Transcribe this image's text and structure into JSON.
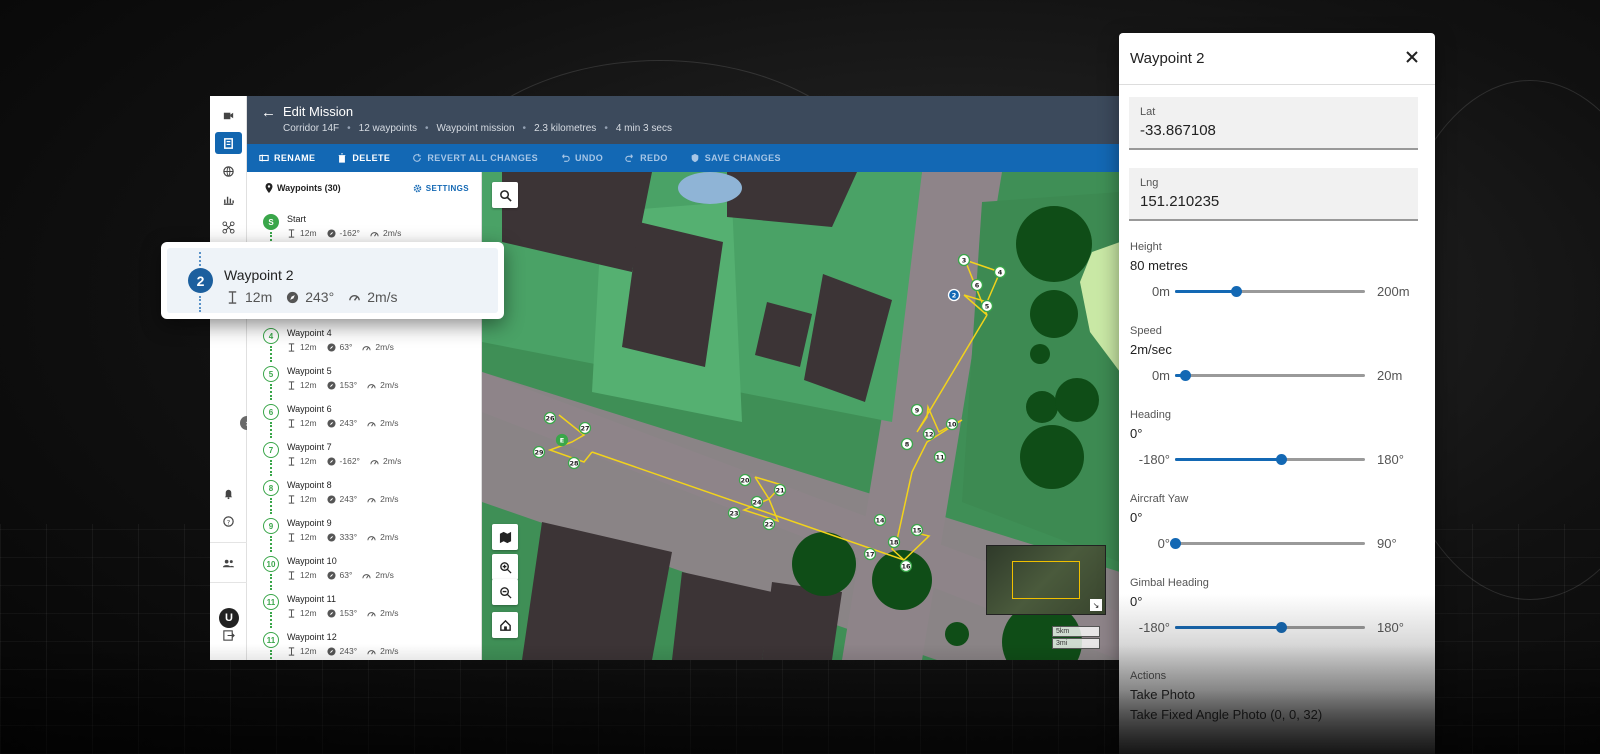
{
  "app": {
    "title": "Edit Mission",
    "meta": [
      "Corridor 14F",
      "12 waypoints",
      "Waypoint mission",
      "2.3 kilometres",
      "4 min 3 secs"
    ]
  },
  "toolbar": {
    "rename": "RENAME",
    "delete": "DELETE",
    "revert": "REVERT ALL CHANGES",
    "undo": "UNDO",
    "redo": "REDO",
    "save": "SAVE CHANGES"
  },
  "list": {
    "header": "Waypoints (30)",
    "settings": "SETTINGS",
    "items": [
      {
        "badge": "S",
        "name": "Start",
        "height": "12m",
        "heading": "-162°",
        "speed": "2m/s"
      },
      {
        "badge": "4",
        "name": "Waypoint 4",
        "height": "12m",
        "heading": "63°",
        "speed": "2m/s"
      },
      {
        "badge": "5",
        "name": "Waypoint 5",
        "height": "12m",
        "heading": "153°",
        "speed": "2m/s"
      },
      {
        "badge": "6",
        "name": "Waypoint 6",
        "height": "12m",
        "heading": "243°",
        "speed": "2m/s"
      },
      {
        "badge": "7",
        "name": "Waypoint 7",
        "height": "12m",
        "heading": "-162°",
        "speed": "2m/s"
      },
      {
        "badge": "8",
        "name": "Waypoint 8",
        "height": "12m",
        "heading": "243°",
        "speed": "2m/s"
      },
      {
        "badge": "9",
        "name": "Waypoint 9",
        "height": "12m",
        "heading": "333°",
        "speed": "2m/s"
      },
      {
        "badge": "10",
        "name": "Waypoint 10",
        "height": "12m",
        "heading": "63°",
        "speed": "2m/s"
      },
      {
        "badge": "11",
        "name": "Waypoint 11",
        "height": "12m",
        "heading": "153°",
        "speed": "2m/s"
      },
      {
        "badge": "11",
        "name": "Waypoint 12",
        "height": "12m",
        "heading": "243°",
        "speed": "2m/s"
      }
    ]
  },
  "popout": {
    "number": "2",
    "name": "Waypoint 2",
    "height": "12m",
    "heading": "243°",
    "speed": "2m/s"
  },
  "map": {
    "markers": [
      "3",
      "4",
      "2",
      "6",
      "5",
      "9",
      "10",
      "8",
      "12",
      "11",
      "26",
      "27",
      "E",
      "29",
      "28",
      "20",
      "21",
      "24",
      "23",
      "22",
      "14",
      "15",
      "18",
      "17",
      "16"
    ],
    "scale_km": "5km",
    "scale_mi": "3mi"
  },
  "panel": {
    "title": "Waypoint 2",
    "lat_label": "Lat",
    "lat_value": "-33.867108",
    "lng_label": "Lng",
    "lng_value": "151.210235",
    "sliders": [
      {
        "label": "Height",
        "value": "80 metres",
        "min": "0m",
        "max": "200m",
        "fraction": 0.32
      },
      {
        "label": "Speed",
        "value": "2m/sec",
        "min": "0m",
        "max": "20m",
        "fraction": 0.05
      },
      {
        "label": "Heading",
        "value": "0°",
        "min": "-180°",
        "max": "180°",
        "fraction": 0.56
      },
      {
        "label": "Aircraft Yaw",
        "value": "0°",
        "min": "0°",
        "max": "90°",
        "fraction": 0.0
      },
      {
        "label": "Gimbal Heading",
        "value": "0°",
        "min": "-180°",
        "max": "180°",
        "fraction": 0.56
      }
    ],
    "actions_label": "Actions",
    "actions": [
      "Take Photo",
      "Take Fixed Angle Photo (0, 0, 32)"
    ]
  },
  "colors": {
    "primary": "#1368b4",
    "header": "#3c4a5c",
    "waypoint": "#3aa64a",
    "route": "#f2d31b"
  }
}
